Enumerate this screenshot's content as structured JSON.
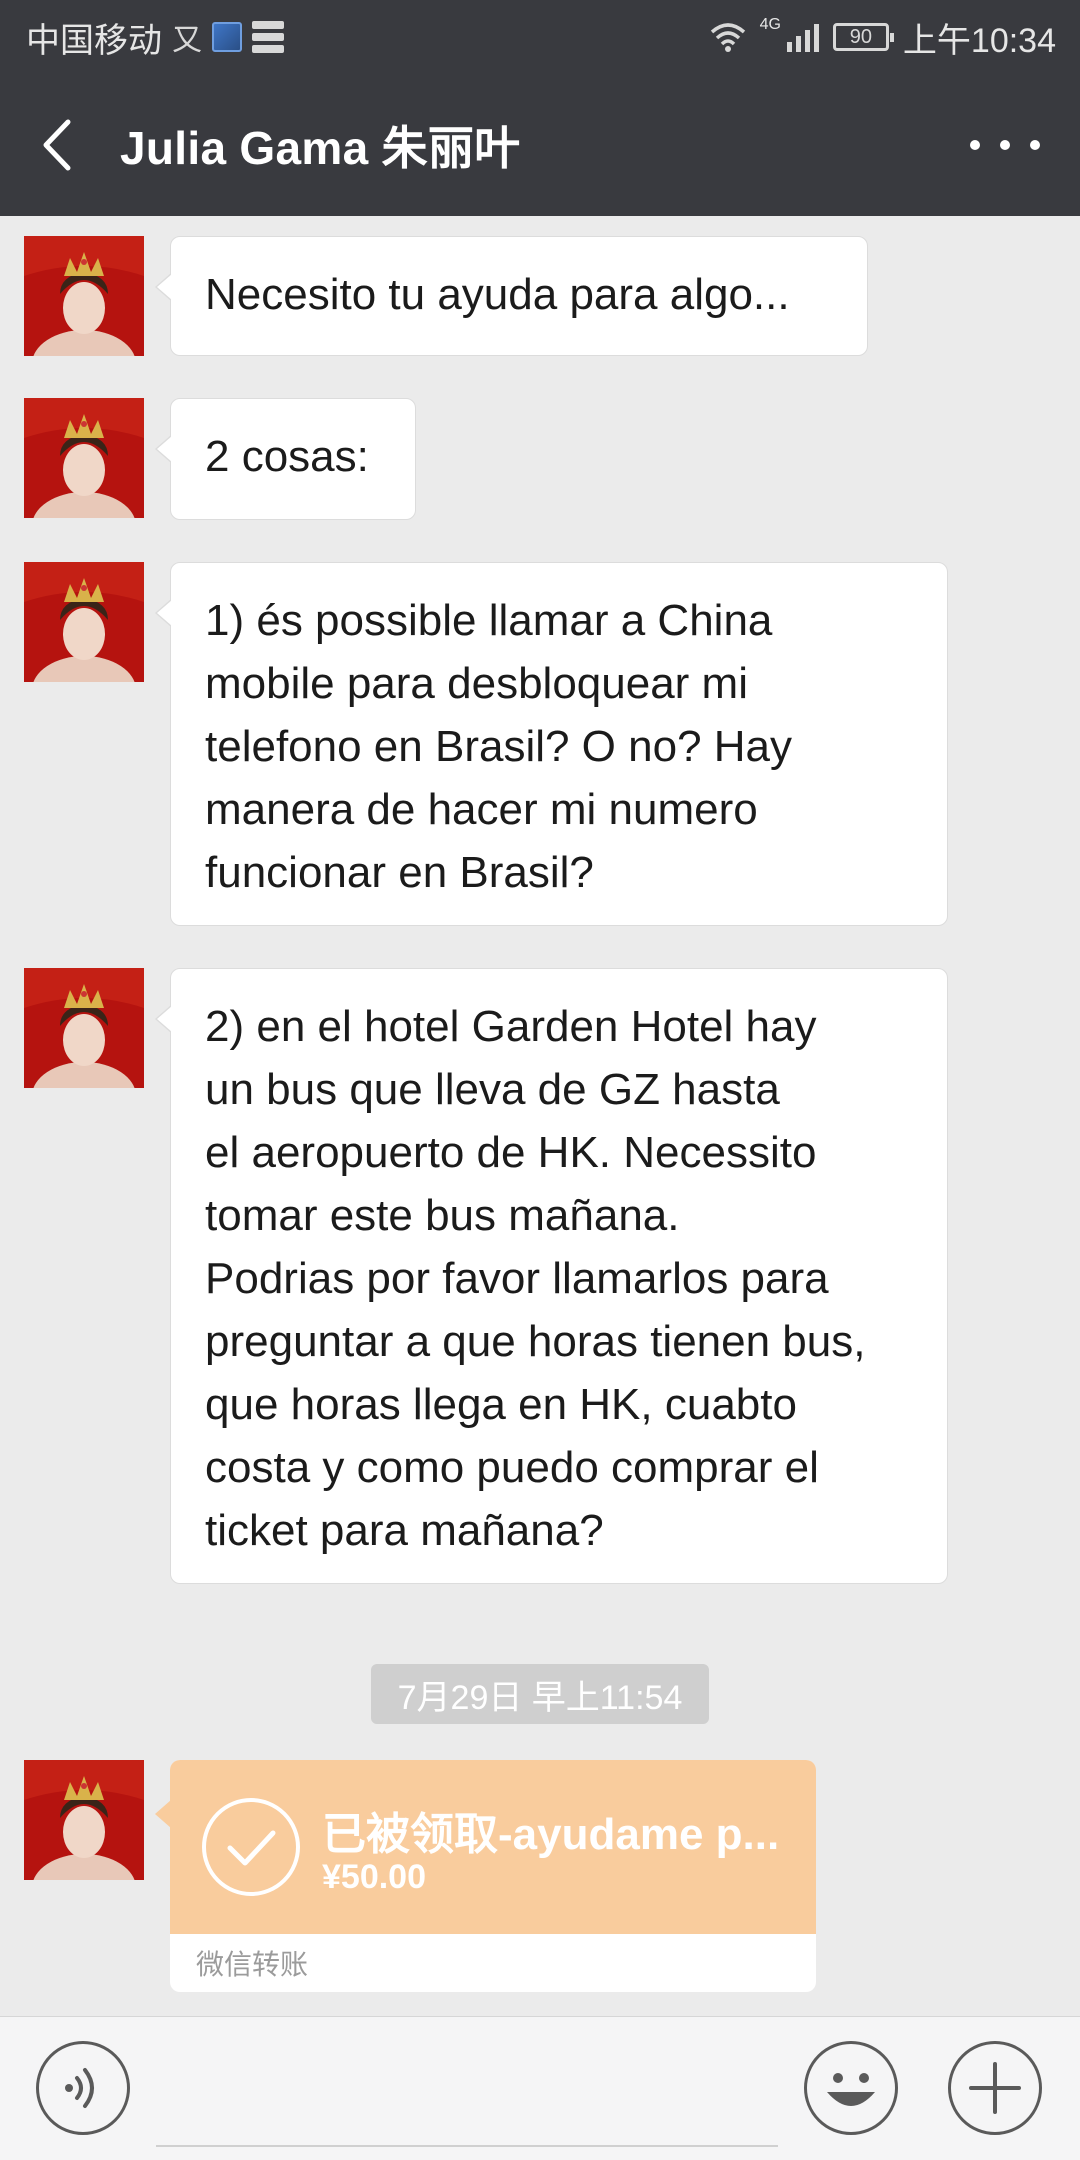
{
  "status_bar": {
    "carrier": "中国移动",
    "carrier_glyph": "⼜",
    "network": "4G",
    "battery": "90",
    "time": "上午10:34"
  },
  "header": {
    "title": "Julia Gama 朱丽叶"
  },
  "messages": [
    {
      "lines": [
        "Necesito tu ayuda para algo..."
      ]
    },
    {
      "lines": [
        "2 cosas:"
      ]
    },
    {
      "lines": [
        "1) és possible llamar a China",
        "mobile para desbloquear mi",
        "telefono en Brasil? O no? Hay",
        "manera de hacer mi numero",
        "funcionar en Brasil?"
      ]
    },
    {
      "lines": [
        "2) en el hotel Garden Hotel hay",
        "un bus que lleva de GZ hasta",
        "el aeropuerto de HK. Necessito",
        "tomar este bus mañana.",
        "Podrias por favor llamarlos para",
        "preguntar a que horas tienen bus,",
        "que horas llega en HK, cuabto",
        "costa y como puedo comprar el",
        "ticket para mañana?"
      ]
    }
  ],
  "timestamp": "7月29日 早上11:54",
  "transfer": {
    "title": "已被领取-ayudame p...",
    "amount": "¥50.00",
    "source": "微信转账"
  },
  "icons": {
    "back": "chevron-left-icon",
    "more": "more-dots-icon",
    "voice": "voice-icon",
    "emoji": "emoji-icon",
    "plus": "plus-icon",
    "check": "check-circle-icon"
  },
  "colors": {
    "bar": "#393a3f",
    "background": "#ebebeb",
    "bubble": "#ffffff",
    "transfer": "#f9cc9d",
    "timestamp_bg": "#cfcfcf"
  }
}
